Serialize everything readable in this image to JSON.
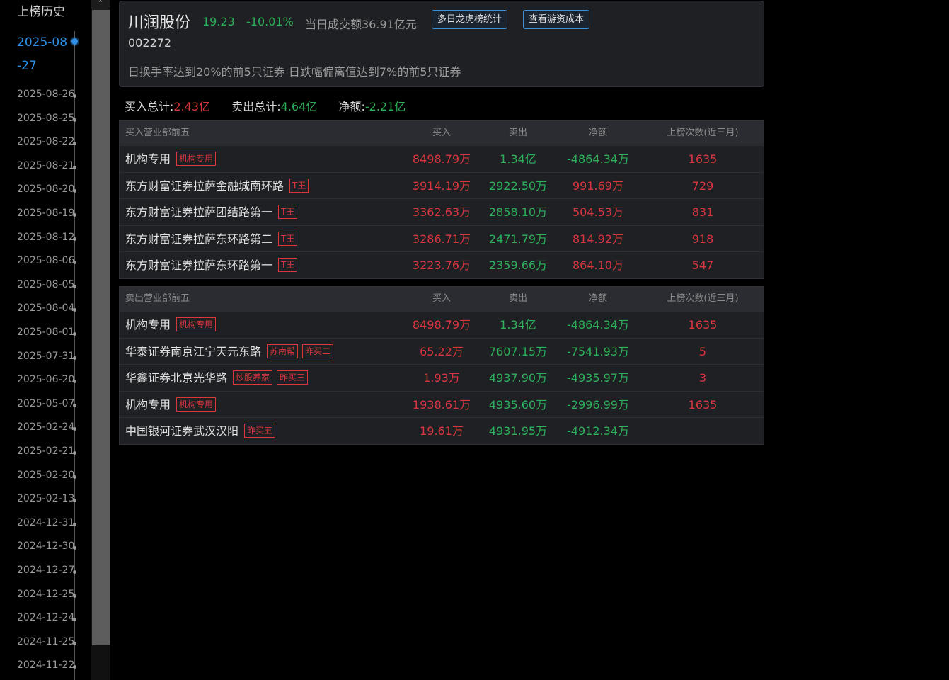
{
  "sidebar": {
    "title": "上榜历史",
    "dates": [
      {
        "label": "2025-08-27",
        "active": true
      },
      {
        "label": "2025-08-26"
      },
      {
        "label": "2025-08-25"
      },
      {
        "label": "2025-08-22"
      },
      {
        "label": "2025-08-21"
      },
      {
        "label": "2025-08-20"
      },
      {
        "label": "2025-08-19"
      },
      {
        "label": "2025-08-12"
      },
      {
        "label": "2025-08-06"
      },
      {
        "label": "2025-08-05"
      },
      {
        "label": "2025-08-04"
      },
      {
        "label": "2025-08-01"
      },
      {
        "label": "2025-07-31"
      },
      {
        "label": "2025-06-20"
      },
      {
        "label": "2025-05-07"
      },
      {
        "label": "2025-02-24"
      },
      {
        "label": "2025-02-21"
      },
      {
        "label": "2025-02-20"
      },
      {
        "label": "2025-02-13"
      },
      {
        "label": "2024-12-31"
      },
      {
        "label": "2024-12-30"
      },
      {
        "label": "2024-12-27"
      },
      {
        "label": "2024-12-25"
      },
      {
        "label": "2024-12-24"
      },
      {
        "label": "2024-11-25"
      },
      {
        "label": "2024-11-22"
      }
    ]
  },
  "scroll_up_glyph": "⌃",
  "header": {
    "name": "川润股份",
    "price": "19.23",
    "change_pct": "-10.01%",
    "turnover": "当日成交额36.91亿元",
    "btn_multi_day": "多日龙虎榜统计",
    "btn_hot_money": "查看游资成本",
    "code": "002272",
    "reason": "日换手率达到20%的前5只证券 日跌幅偏离值达到7%的前5只证券"
  },
  "summary": {
    "buy_label": "买入总计:",
    "buy_value": "2.43亿",
    "sell_label": "卖出总计:",
    "sell_value": "4.64亿",
    "net_label": "净额:",
    "net_value": "-2.21亿"
  },
  "columns": {
    "buy": "买入",
    "sell": "卖出",
    "net": "净额",
    "count": "上榜次数(近三月)"
  },
  "buy_table": {
    "title": "买入营业部前五",
    "rows": [
      {
        "name": "机构专用",
        "tags": [
          "机构专用"
        ],
        "buy": "8498.79万",
        "sell": "1.34亿",
        "net": "-4864.34万",
        "net_sign": "neg",
        "count": "1635"
      },
      {
        "name": "东方财富证券拉萨金融城南环路",
        "tags": [
          "T王"
        ],
        "buy": "3914.19万",
        "sell": "2922.50万",
        "net": "991.69万",
        "net_sign": "pos",
        "count": "729"
      },
      {
        "name": "东方财富证券拉萨团结路第一",
        "tags": [
          "T王"
        ],
        "buy": "3362.63万",
        "sell": "2858.10万",
        "net": "504.53万",
        "net_sign": "pos",
        "count": "831"
      },
      {
        "name": "东方财富证券拉萨东环路第二",
        "tags": [
          "T王"
        ],
        "buy": "3286.71万",
        "sell": "2471.79万",
        "net": "814.92万",
        "net_sign": "pos",
        "count": "918"
      },
      {
        "name": "东方财富证券拉萨东环路第一",
        "tags": [
          "T王"
        ],
        "buy": "3223.76万",
        "sell": "2359.66万",
        "net": "864.10万",
        "net_sign": "pos",
        "count": "547"
      }
    ]
  },
  "sell_table": {
    "title": "卖出营业部前五",
    "rows": [
      {
        "name": "机构专用",
        "tags": [
          "机构专用"
        ],
        "buy": "8498.79万",
        "sell": "1.34亿",
        "net": "-4864.34万",
        "net_sign": "neg",
        "count": "1635"
      },
      {
        "name": "华泰证券南京江宁天元东路",
        "tags": [
          "苏南帮",
          "昨买二"
        ],
        "buy": "65.22万",
        "sell": "7607.15万",
        "net": "-7541.93万",
        "net_sign": "neg",
        "count": "5"
      },
      {
        "name": "华鑫证券北京光华路",
        "tags": [
          "炒股养家",
          "昨买三"
        ],
        "buy": "1.93万",
        "sell": "4937.90万",
        "net": "-4935.97万",
        "net_sign": "neg",
        "count": "3"
      },
      {
        "name": "机构专用",
        "tags": [
          "机构专用"
        ],
        "buy": "1938.61万",
        "sell": "4935.60万",
        "net": "-2996.99万",
        "net_sign": "neg",
        "count": "1635"
      },
      {
        "name": "中国银河证券武汉汉阳",
        "tags": [
          "昨买五"
        ],
        "buy": "19.61万",
        "sell": "4931.95万",
        "net": "-4912.34万",
        "net_sign": "neg",
        "count": ""
      }
    ]
  },
  "colors": {
    "up_red": "#d9363e",
    "down_green": "#2eb05a",
    "accent_blue": "#2f8fe6"
  }
}
